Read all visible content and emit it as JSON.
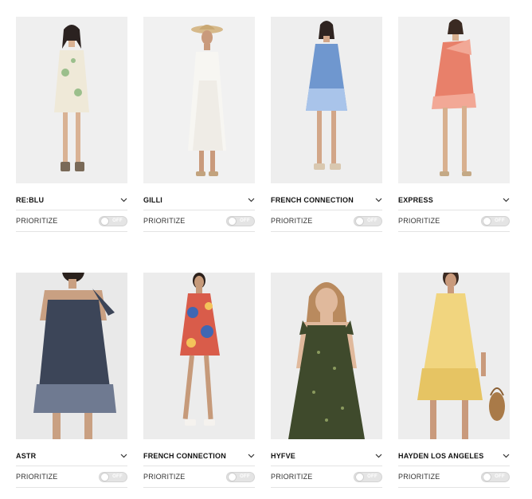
{
  "products": [
    {
      "brand": "RE:BLU",
      "prioritize_label": "PRIORITIZE",
      "toggle_state": "OFF",
      "dress_color": "#efe9d8",
      "accent_color": "#9bbf8c",
      "bg_color": "#efefef"
    },
    {
      "brand": "GILLI",
      "prioritize_label": "PRIORITIZE",
      "toggle_state": "OFF",
      "dress_color": "#f7f6f2",
      "accent_color": "#e9e6de",
      "bg_color": "#f1f1f1"
    },
    {
      "brand": "FRENCH CONNECTION",
      "prioritize_label": "PRIORITIZE",
      "toggle_state": "OFF",
      "dress_color": "#6f97cf",
      "accent_color": "#a9c4ea",
      "bg_color": "#eeeeee"
    },
    {
      "brand": "EXPRESS",
      "prioritize_label": "PRIORITIZE",
      "toggle_state": "OFF",
      "dress_color": "#e8806a",
      "accent_color": "#f2a896",
      "bg_color": "#f0f0f0"
    },
    {
      "brand": "ASTR",
      "prioritize_label": "PRIORITIZE",
      "toggle_state": "OFF",
      "dress_color": "#3c4558",
      "accent_color": "#6f7a91",
      "bg_color": "#e9e9e9"
    },
    {
      "brand": "FRENCH CONNECTION",
      "prioritize_label": "PRIORITIZE",
      "toggle_state": "OFF",
      "dress_color": "#d95c4a",
      "accent_color": "#3f67b3",
      "bg_color": "#ececec"
    },
    {
      "brand": "HYFVE",
      "prioritize_label": "PRIORITIZE",
      "toggle_state": "OFF",
      "dress_color": "#3f4a2c",
      "accent_color": "#8a9a5e",
      "bg_color": "#ededed"
    },
    {
      "brand": "HAYDEN LOS ANGELES",
      "prioritize_label": "PRIORITIZE",
      "toggle_state": "OFF",
      "dress_color": "#f1d57f",
      "accent_color": "#e6c463",
      "bg_color": "#ededed"
    }
  ]
}
